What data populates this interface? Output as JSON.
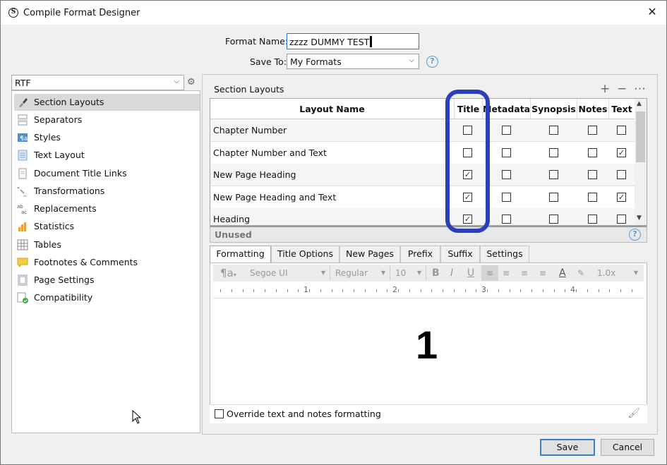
{
  "window": {
    "title": "Compile Format Designer",
    "app_icon": "S",
    "close_glyph": "✕"
  },
  "format": {
    "name_label": "Format Name:",
    "name_value": "zzzz DUMMY TEST",
    "save_label": "Save To:",
    "save_value": "My Formats"
  },
  "output": {
    "value": "RTF"
  },
  "sidebar": {
    "items": [
      {
        "label": "Section Layouts",
        "icon": "paintbrush-icon"
      },
      {
        "label": "Separators",
        "icon": "separators-icon"
      },
      {
        "label": "Styles",
        "icon": "styles-icon"
      },
      {
        "label": "Text Layout",
        "icon": "text-layout-icon"
      },
      {
        "label": "Document Title Links",
        "icon": "document-icon"
      },
      {
        "label": "Transformations",
        "icon": "transform-icon"
      },
      {
        "label": "Replacements",
        "icon": "replace-icon"
      },
      {
        "label": "Statistics",
        "icon": "bar-chart-icon"
      },
      {
        "label": "Tables",
        "icon": "table-icon"
      },
      {
        "label": "Footnotes & Comments",
        "icon": "comment-icon"
      },
      {
        "label": "Page Settings",
        "icon": "page-icon"
      },
      {
        "label": "Compatibility",
        "icon": "check-icon"
      }
    ]
  },
  "section_layouts": {
    "header": "Section Layouts",
    "columns": [
      "Layout Name",
      "Title",
      "Metadata",
      "Synopsis",
      "Notes",
      "Text"
    ],
    "rows": [
      {
        "name": "Chapter Number",
        "checks": [
          false,
          false,
          false,
          false,
          false
        ]
      },
      {
        "name": "Chapter Number and Text",
        "checks": [
          false,
          false,
          false,
          false,
          true
        ]
      },
      {
        "name": "New Page Heading",
        "checks": [
          true,
          false,
          false,
          false,
          false
        ]
      },
      {
        "name": "New Page Heading and Text",
        "checks": [
          true,
          false,
          false,
          false,
          true
        ]
      },
      {
        "name": "Heading",
        "checks": [
          true,
          false,
          false,
          false,
          false
        ]
      }
    ],
    "unused_label": "Unused"
  },
  "tabs": [
    "Formatting",
    "Title Options",
    "New Pages",
    "Prefix",
    "Suffix",
    "Settings"
  ],
  "toolbar": {
    "font": "Segoe UI",
    "style": "Regular",
    "size": "10",
    "spacing": "1.0x"
  },
  "ruler": {
    "numbers": [
      "1",
      "2",
      "3",
      "4"
    ]
  },
  "preview": {
    "text": "1"
  },
  "override": {
    "label": "Override text and notes formatting"
  },
  "buttons": {
    "save": "Save",
    "cancel": "Cancel"
  },
  "colors": {
    "highlight": "#2d3fb8",
    "accent": "#3c7fd1"
  }
}
